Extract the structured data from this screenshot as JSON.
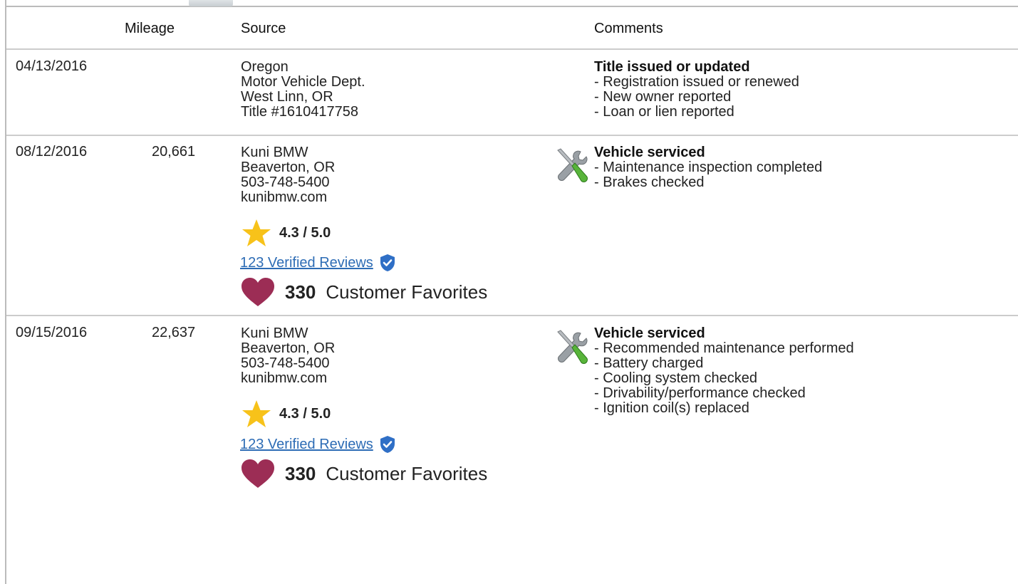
{
  "header": {
    "mileage": "Mileage",
    "source": "Source",
    "comments": "Comments"
  },
  "records": [
    {
      "date": "04/13/2016",
      "mileage": "",
      "source": [
        "Oregon",
        "Motor Vehicle Dept.",
        "West Linn, OR",
        "Title #1610417758"
      ],
      "comment_title": "Title issued or updated",
      "comment_items": [
        "- Registration issued or renewed",
        "- New owner reported",
        "- Loan or lien reported"
      ]
    },
    {
      "date": "08/12/2016",
      "mileage": "20,661",
      "source": [
        "Kuni BMW",
        "Beaverton, OR",
        "503-748-5400",
        "kunibmw.com"
      ],
      "rating": "4.3 / 5.0",
      "reviews": "123 Verified Reviews",
      "favorites_count": "330",
      "favorites_label": "Customer Favorites",
      "comment_icon": "tools-icon",
      "comment_title": "Vehicle serviced",
      "comment_items": [
        "- Maintenance inspection completed",
        "- Brakes checked"
      ]
    },
    {
      "date": "09/15/2016",
      "mileage": "22,637",
      "source": [
        "Kuni BMW",
        "Beaverton, OR",
        "503-748-5400",
        "kunibmw.com"
      ],
      "rating": "4.3 / 5.0",
      "reviews": "123 Verified Reviews",
      "favorites_count": "330",
      "favorites_label": "Customer Favorites",
      "comment_icon": "tools-icon",
      "comment_title": "Vehicle serviced",
      "comment_items": [
        "- Recommended maintenance performed",
        "- Battery charged",
        "- Cooling system checked",
        "- Drivability/performance checked",
        "- Ignition coil(s) replaced"
      ]
    }
  ],
  "colors": {
    "link": "#2d6cb5",
    "star": "#f7c21a",
    "heart": "#9c2d55",
    "shield": "#2f6fc6",
    "divider": "#cccccc"
  }
}
